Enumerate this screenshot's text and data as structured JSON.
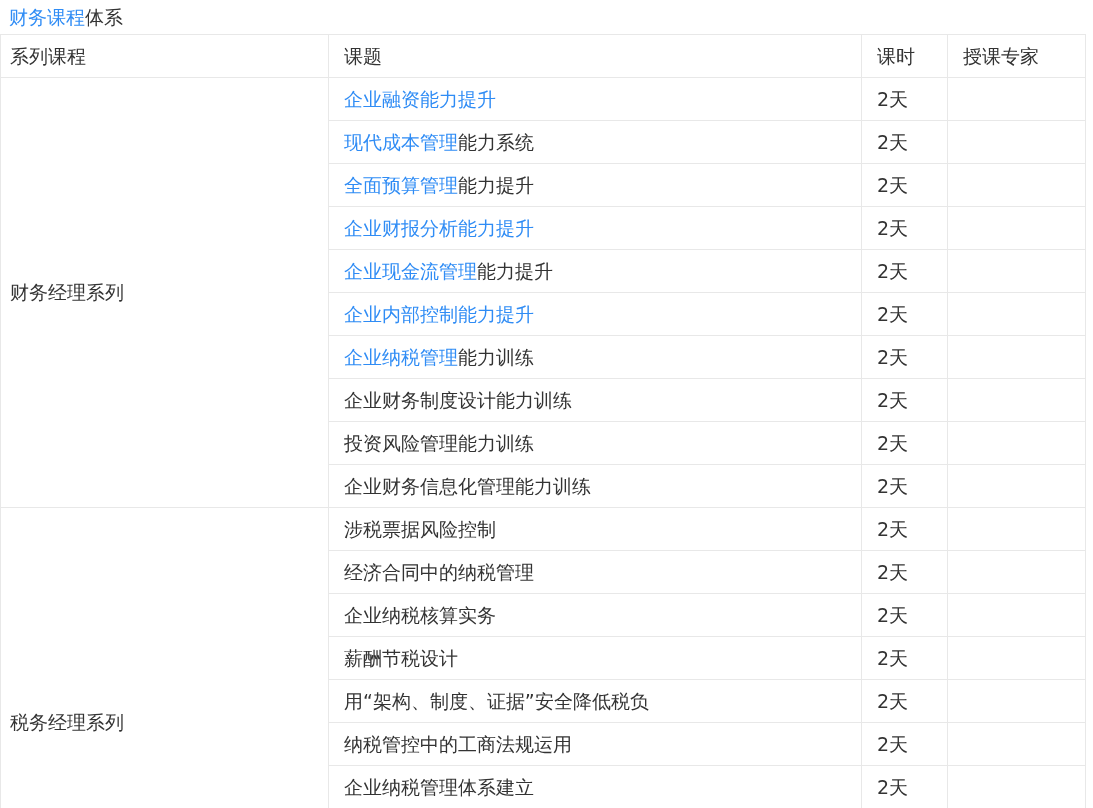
{
  "title": {
    "link": "财务课程",
    "text": "体系"
  },
  "columns": [
    "系列课程",
    "课题",
    "课时",
    "授课专家"
  ],
  "groups": [
    {
      "name": "财务经理系列",
      "rows": [
        {
          "link": "企业融资能力提升",
          "text": "",
          "hours": "2天"
        },
        {
          "link": "现代成本管理",
          "text": "能力系统",
          "hours": "2天"
        },
        {
          "link": "全面预算管理",
          "text": "能力提升",
          "hours": "2天"
        },
        {
          "link": "企业财报分析能力提升",
          "text": "",
          "hours": "2天"
        },
        {
          "link": "企业现金流管理",
          "text": "能力提升",
          "hours": "2天"
        },
        {
          "link": "企业内部控制能力提升",
          "text": "",
          "hours": "2天"
        },
        {
          "link": "企业纳税管理",
          "text": "能力训练",
          "hours": "2天"
        },
        {
          "link": "",
          "text": "企业财务制度设计能力训练",
          "hours": "2天"
        },
        {
          "link": "",
          "text": "投资风险管理能力训练",
          "hours": "2天"
        },
        {
          "link": "",
          "text": "企业财务信息化管理能力训练",
          "hours": "2天"
        }
      ]
    },
    {
      "name": "税务经理系列",
      "rows": [
        {
          "link": "",
          "text": "涉税票据风险控制",
          "hours": "2天"
        },
        {
          "link": "",
          "text": "经济合同中的纳税管理",
          "hours": "2天"
        },
        {
          "link": "",
          "text": "企业纳税核算实务",
          "hours": "2天"
        },
        {
          "link": "",
          "text": "薪酬节税设计",
          "hours": "2天"
        },
        {
          "link": "",
          "text": "用“架构、制度、证据”安全降低税负",
          "hours": "2天"
        },
        {
          "link": "",
          "text": "纳税管控中的工商法规运用",
          "hours": "2天"
        },
        {
          "link": "",
          "text": "企业纳税管理体系建立",
          "hours": "2天"
        }
      ]
    }
  ]
}
